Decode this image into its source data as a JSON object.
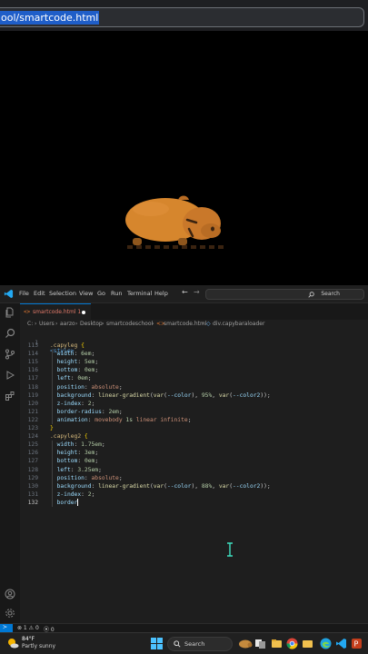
{
  "browser": {
    "url_fragment": "ool/smartcode.html"
  },
  "vscode": {
    "menu": [
      "File",
      "Edit",
      "Selection",
      "View",
      "Go",
      "Run",
      "Terminal",
      "Help"
    ],
    "command_center_placeholder": "Search",
    "tab": {
      "label": "smartcode.html 1",
      "modified": true
    },
    "breadcrumb": [
      "C:",
      "Users",
      "aarzo",
      "Desktop",
      "smartcodeschool",
      "smartcode.html",
      "div.capybaraloader"
    ],
    "first_line": {
      "number": "1",
      "text": "<style>"
    },
    "lines": [
      {
        "n": "113",
        "tokens": [
          [
            ".capyleg",
            "c-sel"
          ],
          [
            " ",
            "c-punc"
          ],
          [
            "{",
            "c-brace"
          ]
        ]
      },
      {
        "n": "114",
        "tokens": [
          [
            "  width",
            "c-prop"
          ],
          [
            ": ",
            "c-punc"
          ],
          [
            "6em",
            "c-num"
          ],
          [
            ";",
            "c-punc"
          ]
        ]
      },
      {
        "n": "115",
        "tokens": [
          [
            "  height",
            "c-prop"
          ],
          [
            ": ",
            "c-punc"
          ],
          [
            "5em",
            "c-num"
          ],
          [
            ";",
            "c-punc"
          ]
        ]
      },
      {
        "n": "116",
        "tokens": [
          [
            "  bottom",
            "c-prop"
          ],
          [
            ": ",
            "c-punc"
          ],
          [
            "0em",
            "c-num"
          ],
          [
            ";",
            "c-punc"
          ]
        ]
      },
      {
        "n": "117",
        "tokens": [
          [
            "  left",
            "c-prop"
          ],
          [
            ": ",
            "c-punc"
          ],
          [
            "0em",
            "c-num"
          ],
          [
            ";",
            "c-punc"
          ]
        ]
      },
      {
        "n": "118",
        "tokens": [
          [
            "  position",
            "c-prop"
          ],
          [
            ": ",
            "c-punc"
          ],
          [
            "absolute",
            "c-val"
          ],
          [
            ";",
            "c-punc"
          ]
        ]
      },
      {
        "n": "119",
        "tokens": [
          [
            "  background",
            "c-prop"
          ],
          [
            ": ",
            "c-punc"
          ],
          [
            "linear-gradient",
            "c-fn"
          ],
          [
            "(",
            "c-punc"
          ],
          [
            "var",
            "c-fn"
          ],
          [
            "(",
            "c-punc"
          ],
          [
            "--color",
            "c-prop"
          ],
          [
            "), ",
            "c-punc"
          ],
          [
            "95%",
            "c-num"
          ],
          [
            ", ",
            "c-punc"
          ],
          [
            "var",
            "c-fn"
          ],
          [
            "(",
            "c-punc"
          ],
          [
            "--color2",
            "c-prop"
          ],
          [
            "));",
            "c-punc"
          ]
        ]
      },
      {
        "n": "120",
        "tokens": [
          [
            "  z-index",
            "c-prop"
          ],
          [
            ": ",
            "c-punc"
          ],
          [
            "2",
            "c-num"
          ],
          [
            ";",
            "c-punc"
          ]
        ]
      },
      {
        "n": "121",
        "tokens": [
          [
            "  border-radius",
            "c-prop"
          ],
          [
            ": ",
            "c-punc"
          ],
          [
            "2em",
            "c-num"
          ],
          [
            ";",
            "c-punc"
          ]
        ]
      },
      {
        "n": "122",
        "tokens": [
          [
            "  animation",
            "c-prop"
          ],
          [
            ": ",
            "c-punc"
          ],
          [
            "movebody ",
            "c-val"
          ],
          [
            "1s ",
            "c-num"
          ],
          [
            "linear ",
            "c-val"
          ],
          [
            "infinite",
            "c-val"
          ],
          [
            ";",
            "c-punc"
          ]
        ]
      },
      {
        "n": "123",
        "tokens": [
          [
            "}",
            "c-brace"
          ]
        ]
      },
      {
        "n": "124",
        "tokens": [
          [
            ".capyleg2",
            "c-sel"
          ],
          [
            " ",
            "c-punc"
          ],
          [
            "{",
            "c-brace"
          ]
        ]
      },
      {
        "n": "125",
        "tokens": [
          [
            "  width",
            "c-prop"
          ],
          [
            ": ",
            "c-punc"
          ],
          [
            "1.75em",
            "c-num"
          ],
          [
            ";",
            "c-punc"
          ]
        ]
      },
      {
        "n": "126",
        "tokens": [
          [
            "  height",
            "c-prop"
          ],
          [
            ": ",
            "c-punc"
          ],
          [
            "3em",
            "c-num"
          ],
          [
            ";",
            "c-punc"
          ]
        ]
      },
      {
        "n": "127",
        "tokens": [
          [
            "  bottom",
            "c-prop"
          ],
          [
            ": ",
            "c-punc"
          ],
          [
            "0em",
            "c-num"
          ],
          [
            ";",
            "c-punc"
          ]
        ]
      },
      {
        "n": "128",
        "tokens": [
          [
            "  left",
            "c-prop"
          ],
          [
            ": ",
            "c-punc"
          ],
          [
            "3.25em",
            "c-num"
          ],
          [
            ";",
            "c-punc"
          ]
        ]
      },
      {
        "n": "129",
        "tokens": [
          [
            "  position",
            "c-prop"
          ],
          [
            ": ",
            "c-punc"
          ],
          [
            "absolute",
            "c-val"
          ],
          [
            ";",
            "c-punc"
          ]
        ]
      },
      {
        "n": "130",
        "tokens": [
          [
            "  background",
            "c-prop"
          ],
          [
            ": ",
            "c-punc"
          ],
          [
            "linear-gradient",
            "c-fn"
          ],
          [
            "(",
            "c-punc"
          ],
          [
            "var",
            "c-fn"
          ],
          [
            "(",
            "c-punc"
          ],
          [
            "--color",
            "c-prop"
          ],
          [
            "), ",
            "c-punc"
          ],
          [
            "88%",
            "c-num"
          ],
          [
            ", ",
            "c-punc"
          ],
          [
            "var",
            "c-fn"
          ],
          [
            "(",
            "c-punc"
          ],
          [
            "--color2",
            "c-prop"
          ],
          [
            "));",
            "c-punc"
          ]
        ]
      },
      {
        "n": "131",
        "tokens": [
          [
            "  z-index",
            "c-prop"
          ],
          [
            ": ",
            "c-punc"
          ],
          [
            "2",
            "c-num"
          ],
          [
            ";",
            "c-punc"
          ]
        ]
      },
      {
        "n": "132",
        "tokens": [
          [
            "  border",
            "c-prop"
          ]
        ],
        "active": true
      }
    ],
    "status": {
      "problems": "⊗ 1  ⚠ 0",
      "ports": "⦿ 0"
    }
  },
  "taskbar": {
    "weather_temp": "84°F",
    "weather_desc": "Partly sunny",
    "search_label": "Search"
  },
  "colors": {
    "capy_body": "#d6862d",
    "capy_dark": "#3a2310",
    "accent": "#0078d4"
  }
}
